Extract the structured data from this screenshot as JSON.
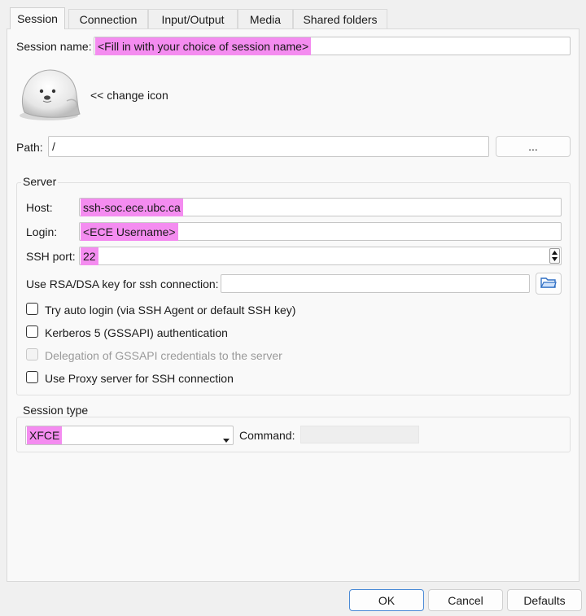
{
  "tabs": [
    "Session",
    "Connection",
    "Input/Output",
    "Media",
    "Shared folders"
  ],
  "session": {
    "name_label": "Session name:",
    "name_value": "<Fill in with your choice of session name>",
    "change_icon": "<< change icon",
    "path_label": "Path:",
    "path_value": "/",
    "browse_label": "..."
  },
  "server": {
    "title": "Server",
    "host_label": "Host:",
    "host_value": "ssh-soc.ece.ubc.ca",
    "login_label": "Login:",
    "login_value": "<ECE Username>",
    "port_label": "SSH port:",
    "port_value": "22",
    "rsa_label": "Use RSA/DSA key for ssh connection:",
    "rsa_value": "",
    "options": [
      {
        "label": "Try auto login (via SSH Agent or default SSH key)",
        "checked": false,
        "enabled": true
      },
      {
        "label": "Kerberos 5 (GSSAPI) authentication",
        "checked": false,
        "enabled": true
      },
      {
        "label": "Delegation of GSSAPI credentials to the server",
        "checked": false,
        "enabled": false
      },
      {
        "label": "Use Proxy server for SSH connection",
        "checked": false,
        "enabled": true
      }
    ]
  },
  "session_type": {
    "title": "Session type",
    "value": "XFCE",
    "command_label": "Command:",
    "command_value": ""
  },
  "footer": {
    "ok": "OK",
    "cancel": "Cancel",
    "defaults": "Defaults"
  },
  "colors": {
    "highlight": "#f48cf0",
    "primary_border": "#4a8ad6",
    "folder_icon": "#2f6fc4"
  },
  "icons": {
    "session_icon": "seal-icon",
    "browse_key": "folder-icon",
    "spinner": "spinner-arrows-icon",
    "dropdown": "chevron-down-icon"
  }
}
